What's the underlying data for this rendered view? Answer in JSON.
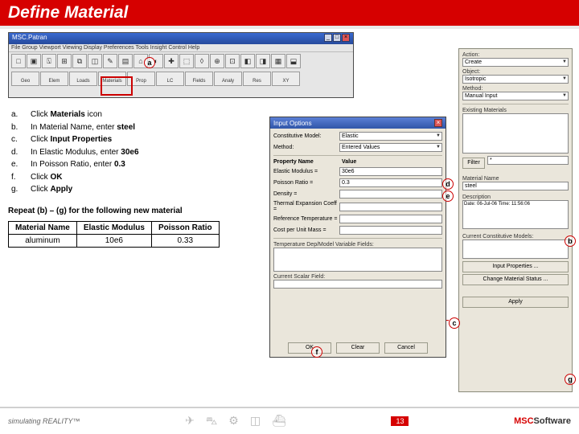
{
  "header": {
    "title": "Define Material"
  },
  "patran": {
    "title": "MSC.Patran",
    "menu": "File  Group  Viewport  Viewing  Display  Preferences  Tools  Insight Control  Help",
    "materials_label": "Materials"
  },
  "steps": {
    "a": {
      "letter": "a.",
      "pre": "Click ",
      "bold": "Materials",
      "post": " icon"
    },
    "b": {
      "letter": "b.",
      "pre": "In Material Name, enter ",
      "bold": "steel",
      "post": ""
    },
    "c": {
      "letter": "c.",
      "pre": "Click ",
      "bold": "Input Properties",
      "post": ""
    },
    "d": {
      "letter": "d.",
      "pre": "In Elastic Modulus, enter ",
      "bold": "30e6",
      "post": ""
    },
    "e": {
      "letter": "e.",
      "pre": "In Poisson Ratio, enter ",
      "bold": "0.3",
      "post": ""
    },
    "f": {
      "letter": "f.",
      "pre": "Click ",
      "bold": "OK",
      "post": ""
    },
    "g": {
      "letter": "g.",
      "pre": "Click ",
      "bold": "Apply",
      "post": ""
    }
  },
  "callouts": {
    "a": "a",
    "b": "b",
    "c": "c",
    "d": "d",
    "e": "e",
    "f": "f",
    "g": "g"
  },
  "repeat": "Repeat (b) – (g) for the following new material",
  "table": {
    "h1": "Material Name",
    "h2": "Elastic Modulus",
    "h3": "Poisson Ratio",
    "r1c1": "aluminum",
    "r1c2": "10e6",
    "r1c3": "0.33"
  },
  "side": {
    "action_lbl": "Action:",
    "action_val": "Create",
    "object_lbl": "Object:",
    "object_val": "Isotropic",
    "method_lbl": "Method:",
    "method_val": "Manual Input",
    "existing_lbl": "Existing Materials",
    "filter_lbl": "Filter",
    "filter_val": "*",
    "matname_lbl": "Material Name",
    "matname_val": "steel",
    "desc_lbl": "Description",
    "desc_val": "Date: 06-Jul-06   Time: 11:56:06",
    "btn_input": "Input Properties ...",
    "btn_change": "Change Material Status ...",
    "btn_apply": "Apply",
    "sep_lbl": "Current Constitutive Models:"
  },
  "dialog": {
    "title": "Input Options",
    "cm_lbl": "Constitutive Model:",
    "cm_val": "Elastic",
    "method_lbl": "Method:",
    "method_val": "Entered Values",
    "propname": "Property Name",
    "value": "Value",
    "em_lbl": "Elastic Modulus =",
    "em_val": "30e6",
    "pr_lbl": "Poisson Ratio =",
    "pr_val": "0.3",
    "density_lbl": "Density =",
    "therm_lbl": "Thermal Expansion Coeff =",
    "refstrain_lbl": "Reference Temperature =",
    "cost_lbl": "Cost per Unit Mass =",
    "curfield_lbl": "Current Scalar Field:",
    "tempdep_lbl": "Temperature Dep/Model Variable Fields:",
    "tempdep_val": "",
    "btn_ok": "OK",
    "btn_clear": "Clear",
    "btn_cancel": "Cancel"
  },
  "footer": {
    "sim": "simulating REALITY™",
    "page": "13",
    "msc1": "MSC",
    "msc2": "Software"
  }
}
